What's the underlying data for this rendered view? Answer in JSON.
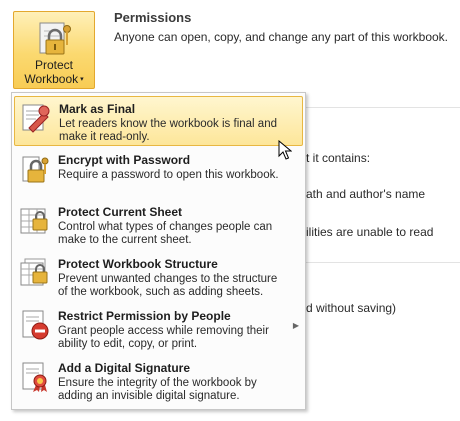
{
  "protect": {
    "line1": "Protect",
    "line2": "Workbook",
    "caret": "▾"
  },
  "permissions": {
    "title": "Permissions",
    "description": "Anyone can open, copy, and change any part of this workbook."
  },
  "background": {
    "line1": "t it contains:",
    "line2": "ath and author's name",
    "line3": "ilities are unable to read",
    "line4": "d without saving)"
  },
  "menu": {
    "items": [
      {
        "title": "Mark as Final",
        "desc": "Let readers know the workbook is final and make it read-only.",
        "icon": "mark-final-icon",
        "selected": true
      },
      {
        "title": "Encrypt with Password",
        "desc": "Require a password to open this workbook.",
        "icon": "encrypt-icon"
      },
      {
        "title": "Protect Current Sheet",
        "desc": "Control what types of changes people can make to the current sheet.",
        "icon": "protect-sheet-icon"
      },
      {
        "title": "Protect Workbook Structure",
        "desc": "Prevent unwanted changes to the structure of the workbook, such as adding sheets.",
        "icon": "protect-structure-icon"
      },
      {
        "title": "Restrict Permission by People",
        "desc": "Grant people access while removing their ability to edit, copy, or print.",
        "icon": "restrict-permission-icon",
        "submenu": true
      },
      {
        "title": "Add a Digital Signature",
        "desc": "Ensure the integrity of the workbook by adding an invisible digital signature.",
        "icon": "signature-icon"
      }
    ]
  },
  "colors": {
    "highlight": "#fde69a",
    "highlight_border": "#e8b742"
  }
}
